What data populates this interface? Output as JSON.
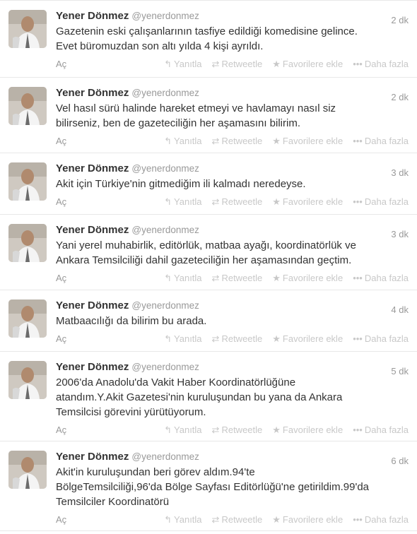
{
  "tweets": [
    {
      "name": "Yener Dönmez",
      "handle": "@yenerdonmez",
      "time": "2 dk",
      "lines": [
        "Gazetenin eski çalışanlarının tasfiye edildiği komedisine gelince.",
        "Evet büromuzdan son altı yılda 4 kişi ayrıldı."
      ]
    },
    {
      "name": "Yener Dönmez",
      "handle": "@yenerdonmez",
      "time": "2 dk",
      "lines": [
        "Vel hasıl sürü halinde hareket etmeyi ve havlamayı nasıl siz",
        "bilirseniz, ben de gazeteciliğin her aşamasını bilirim."
      ]
    },
    {
      "name": "Yener Dönmez",
      "handle": "@yenerdonmez",
      "time": "3 dk",
      "lines": [
        "Akit için Türkiye'nin gitmediğim ili kalmadı neredeyse."
      ]
    },
    {
      "name": "Yener Dönmez",
      "handle": "@yenerdonmez",
      "time": "3 dk",
      "lines": [
        "Yani yerel muhabirlik, editörlük, matbaa ayağı, koordinatörlük ve",
        "Ankara Temsilciliği dahil gazeteciliğin her aşamasından geçtim."
      ]
    },
    {
      "name": "Yener Dönmez",
      "handle": "@yenerdonmez",
      "time": "4 dk",
      "lines": [
        "Matbaacılığı da bilirim bu arada."
      ]
    },
    {
      "name": "Yener Dönmez",
      "handle": "@yenerdonmez",
      "time": "5 dk",
      "lines": [
        "2006'da Anadolu'da Vakit Haber Koordinatörlüğüne",
        "atandım.Y.Akit Gazetesi'nin kuruluşundan bu yana da Ankara",
        "Temsilcisi görevini yürütüyorum."
      ]
    },
    {
      "name": "Yener Dönmez",
      "handle": "@yenerdonmez",
      "time": "6 dk",
      "lines": [
        "Akit'in kuruluşundan beri görev aldım.94'te",
        "BölgeTemsilciliği,96'da Bölge Sayfası Editörlüğü'ne getirildim.99'da",
        "Temsilciler Koordinatörü"
      ]
    }
  ],
  "actions": {
    "open": "Aç",
    "reply": "Yanıtla",
    "retweet": "Retweetle",
    "favorite": "Favorilere ekle",
    "more": "Daha fazla"
  },
  "icons": {
    "reply": "reply-arrow-icon",
    "retweet": "retweet-arrows-icon",
    "favorite": "star-icon",
    "more": "ellipsis-icon"
  },
  "colors": {
    "text": "#333333",
    "muted": "#999999",
    "action": "#c8c8c8",
    "divider": "#e8e8e8"
  }
}
